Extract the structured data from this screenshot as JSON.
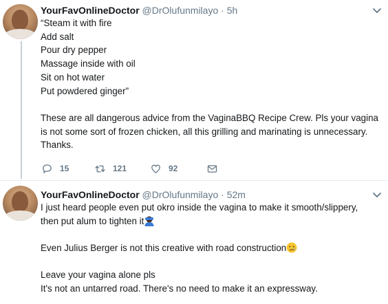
{
  "tweets": [
    {
      "name": "YourFavOnlineDoctor",
      "handle": "@DrOlufunmilayo",
      "dot": "·",
      "time": "5h",
      "lines": [
        "“Steam it with fire",
        "Add salt",
        "Pour dry pepper",
        "Massage inside with oil",
        "Sit on hot water",
        "Put powdered ginger”",
        "",
        "These are all dangerous advice from the VaginaBBQ Recipe Crew. Pls your vagina",
        "is not some sort of frozen chicken, all this grilling and marinating is unnecessary.",
        "Thanks."
      ],
      "actions": {
        "replies": "15",
        "retweets": "121",
        "likes": "92"
      }
    },
    {
      "name": "YourFavOnlineDoctor",
      "handle": "@DrOlufunmilayo",
      "dot": "·",
      "time": "52m",
      "line1": "I just heard people even put okro inside the vagina to make it smooth/slippery,",
      "line2": "then put alum to tighten it",
      "line3": "Even Julius Berger is not this creative with road construction",
      "line4": "Leave your vagina alone pls",
      "line5": "It's not an untarred road. There's no need to make it an expressway."
    }
  ],
  "icons": {
    "chevron": "chevron-down-icon",
    "reply": "reply-icon",
    "retweet": "retweet-icon",
    "like": "heart-icon",
    "dm": "envelope-icon",
    "emoji1": "person-facepalming-emoji",
    "emoji2": "crying-face-emoji"
  },
  "colors": {
    "text": "#14171a",
    "secondary": "#657786",
    "thread_line": "#c4cfd6"
  }
}
